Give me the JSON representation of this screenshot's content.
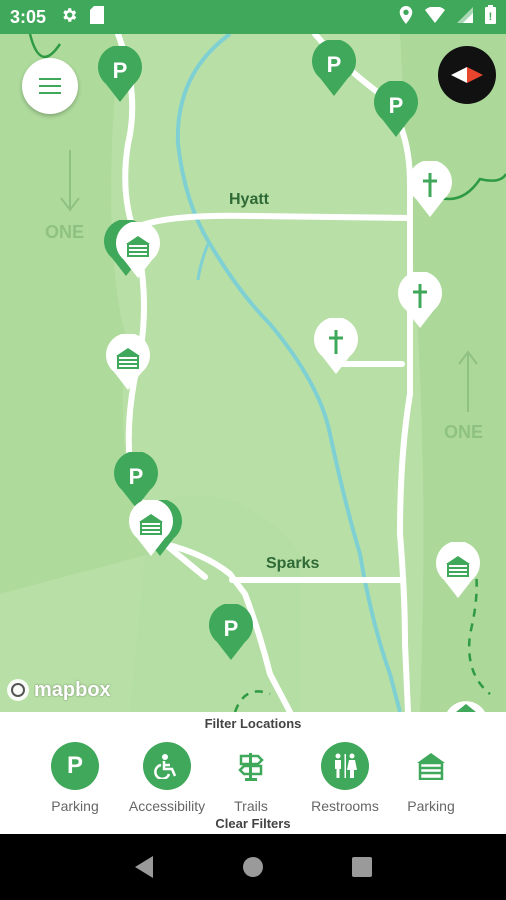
{
  "status_bar": {
    "time": "3:05",
    "left_icons": [
      "gear-icon",
      "sd-card-icon"
    ],
    "right_icons": [
      "location-icon",
      "wifi-icon",
      "signal-icon",
      "battery-icon"
    ]
  },
  "colors": {
    "brand_green": "#3fa85a",
    "map_background": "#b8e0a6",
    "road": "#ffffff",
    "river": "#7fd0d2",
    "trail": "#2e9a44"
  },
  "map": {
    "road_labels": [
      "Hyatt",
      "Sparks"
    ],
    "one_way_labels": [
      "ONE",
      "ONE"
    ],
    "attribution": "mapbox",
    "marker_types": [
      "parking",
      "cabin",
      "restroom"
    ]
  },
  "filter_panel": {
    "title": "Filter Locations",
    "items": [
      {
        "label": "Parking",
        "icon": "parking-icon"
      },
      {
        "label": "Accessibility",
        "icon": "accessibility-icon"
      },
      {
        "label": "Trails",
        "icon": "trail-sign-icon"
      },
      {
        "label": "Restrooms",
        "icon": "restroom-icon"
      },
      {
        "label": "Parking",
        "icon": "cabin-icon"
      }
    ],
    "clear_label": "Clear Filters"
  },
  "nav_bar": {
    "buttons": [
      "back-icon",
      "home-icon",
      "recents-icon"
    ]
  }
}
